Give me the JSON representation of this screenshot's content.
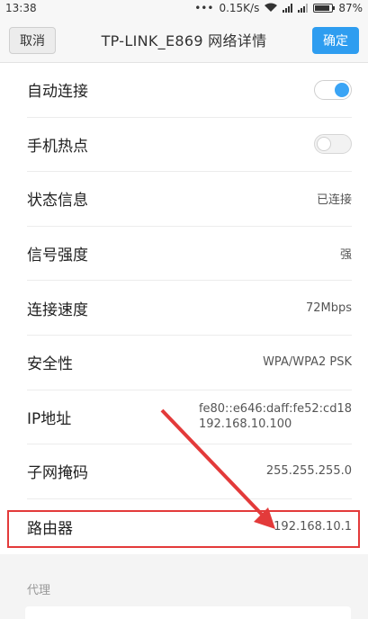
{
  "status_bar": {
    "time": "13:38",
    "dots": "•••",
    "speed": "0.15K/s",
    "battery": "87%",
    "battery_level": 0.87
  },
  "header": {
    "cancel_label": "取消",
    "title": "TP-LINK_E869  网络详情",
    "ok_label": "确定"
  },
  "rows": [
    {
      "label": "自动连接",
      "toggle": "on"
    },
    {
      "label": "手机热点",
      "toggle": "off"
    },
    {
      "label": "状态信息",
      "value": "已连接"
    },
    {
      "label": "信号强度",
      "value": "强"
    },
    {
      "label": "连接速度",
      "value": "72Mbps"
    },
    {
      "label": "安全性",
      "value": "WPA/WPA2 PSK"
    },
    {
      "label": "IP地址",
      "value_line1": "fe80::e646:daff:fe52:cd18",
      "value_line2": "192.168.10.100"
    },
    {
      "label": "子网掩码",
      "value": "255.255.255.0"
    },
    {
      "label": "路由器",
      "value": "192.168.10.1"
    }
  ],
  "proxy_section_label": "代理",
  "colors": {
    "accent": "#2e9df0",
    "annotation": "#e33a3a"
  }
}
